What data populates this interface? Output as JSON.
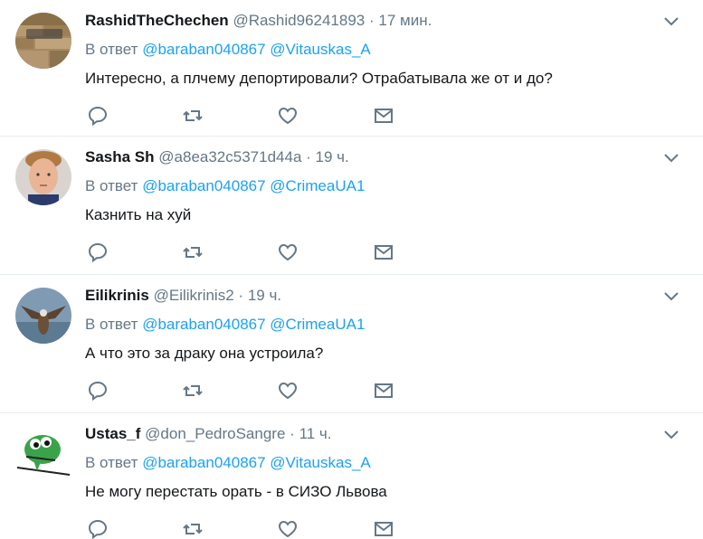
{
  "tweets": [
    {
      "fullname": "RashidTheChechen",
      "username": "@Rashid96241893",
      "dot": "·",
      "time": "17 мин.",
      "reply_prefix": "В ответ",
      "mentions": [
        "@baraban040867",
        "@Vitauskas_A"
      ],
      "text": "Интересно, а плчему депортировали? Отрабатывала же от и до?"
    },
    {
      "fullname": "Sasha Sh",
      "username": "@a8ea32c5371d44a",
      "dot": "·",
      "time": "19 ч.",
      "reply_prefix": "В ответ",
      "mentions": [
        "@baraban040867",
        "@CrimeaUA1"
      ],
      "text": "Казнить на хуй"
    },
    {
      "fullname": "Eilikrinis",
      "username": "@Eilikrinis2",
      "dot": "·",
      "time": "19 ч.",
      "reply_prefix": "В ответ",
      "mentions": [
        "@baraban040867",
        "@CrimeaUA1"
      ],
      "text": "А что это за драку она устроила?"
    },
    {
      "fullname": "Ustas_f",
      "username": "@don_PedroSangre",
      "dot": "·",
      "time": "11 ч.",
      "reply_prefix": "В ответ",
      "mentions": [
        "@baraban040867",
        "@Vitauskas_A"
      ],
      "text": "Не могу перестать орать - в СИЗО Львова"
    }
  ],
  "icons": {
    "menu": "chevron-down-icon",
    "reply": "reply-icon",
    "retweet": "retweet-icon",
    "like": "heart-icon",
    "dm": "envelope-icon"
  },
  "colors": {
    "text": "#14171a",
    "secondary": "#657786",
    "mention": "#1da1f2",
    "divider": "#e6ecf0"
  }
}
